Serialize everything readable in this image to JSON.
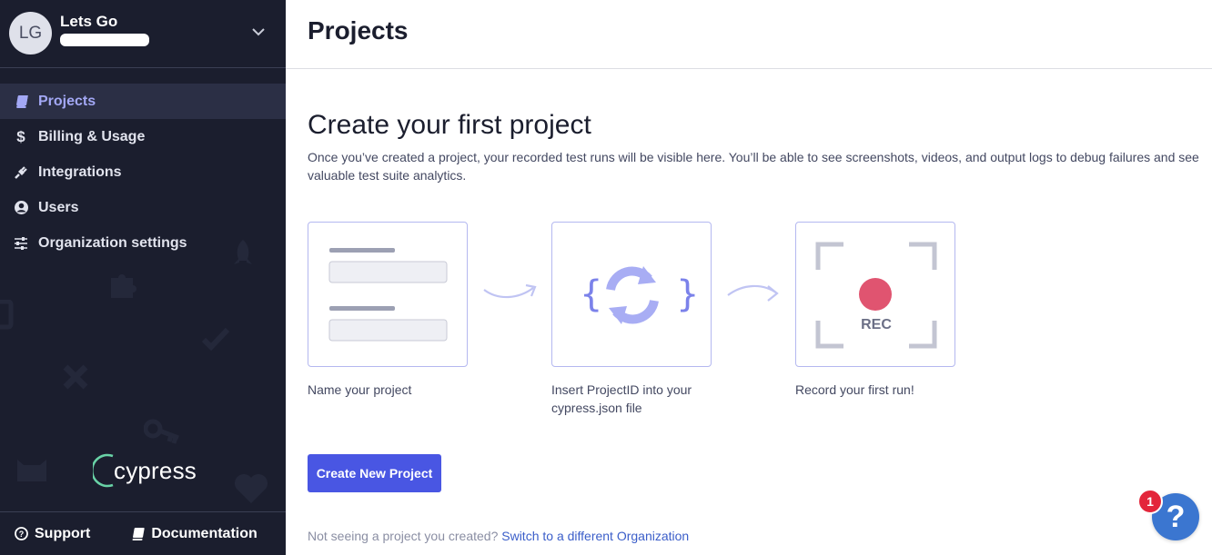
{
  "org": {
    "initials": "LG",
    "name": "Lets Go"
  },
  "nav": {
    "items": [
      {
        "label": "Projects",
        "icon": "book-icon",
        "active": true
      },
      {
        "label": "Billing & Usage",
        "icon": "dollar-icon",
        "active": false
      },
      {
        "label": "Integrations",
        "icon": "plug-icon",
        "active": false
      },
      {
        "label": "Users",
        "icon": "user-circle-icon",
        "active": false
      },
      {
        "label": "Organization settings",
        "icon": "sliders-icon",
        "active": false
      }
    ]
  },
  "brand": {
    "name": "cypress"
  },
  "footer_links": {
    "support": "Support",
    "documentation": "Documentation"
  },
  "header": {
    "title": "Projects"
  },
  "onboarding": {
    "heading": "Create your first project",
    "description": "Once you’ve created a project, your recorded test runs will be visible here. You’ll be able to see screenshots, videos, and output logs to debug failures and see valuable test suite analytics.",
    "steps": [
      {
        "label": "Name your project"
      },
      {
        "label": "Insert ProjectID into your cypress.json file"
      },
      {
        "label": "Record your first run!",
        "rec_text": "REC"
      }
    ],
    "create_button": "Create New Project",
    "note_text": "Not seeing a project you created?",
    "note_link": "Switch to a different Organization"
  },
  "help": {
    "glyph": "?",
    "badge_count": "1"
  },
  "colors": {
    "sidebar_bg": "#1b1e2e",
    "accent": "#4956e3",
    "active_nav_text": "#a3a8f5",
    "rec_red": "#e05470",
    "help_blue": "#3b76d0",
    "badge_red": "#e3263b"
  }
}
